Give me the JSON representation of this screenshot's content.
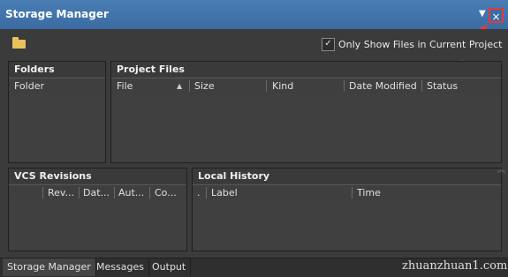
{
  "window": {
    "title": "Storage Manager",
    "menu_glyph": "▼",
    "close_glyph": "×"
  },
  "toolbar": {
    "checkbox_checked": true,
    "checkbox_mark": "✓",
    "checkbox_label": "Only Show Files in Current Project"
  },
  "panels": {
    "folders": {
      "title": "Folders",
      "columns": [
        "Folder"
      ]
    },
    "project_files": {
      "title": "Project Files",
      "columns": [
        "File",
        "Size",
        "Kind",
        "Date Modified",
        "Status"
      ],
      "sort_glyph": "▲"
    },
    "vcs_revisions": {
      "title": "VCS Revisions",
      "columns": [
        "Rev...",
        "Dat...",
        "Aut...",
        "Co..."
      ]
    },
    "local_history": {
      "title": "Local History",
      "columns": [
        ".",
        "Label",
        "Time"
      ]
    }
  },
  "splitter_glyph": "︽",
  "tabs": [
    {
      "label": "Storage Manager",
      "active": true
    },
    {
      "label": "Messages",
      "active": false
    },
    {
      "label": "Output",
      "active": false
    }
  ],
  "watermark": "zhuanzhuan1.com",
  "colors": {
    "titlebar": "#3a6ca3",
    "highlight": "#e23b3b",
    "folder": "#e7c35a",
    "background": "#3b3b3b"
  }
}
